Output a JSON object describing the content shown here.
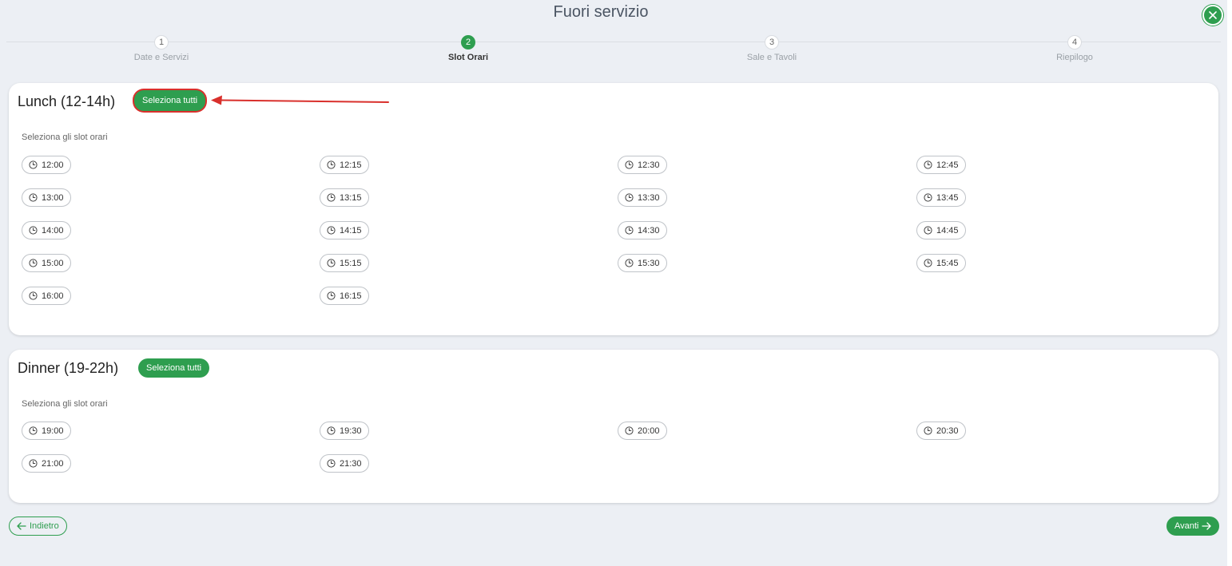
{
  "page_title": "Fuori servizio",
  "steps": [
    {
      "number": "1",
      "label": "Date e Servizi",
      "active": false
    },
    {
      "number": "2",
      "label": "Slot Orari",
      "active": true
    },
    {
      "number": "3",
      "label": "Sale e Tavoli",
      "active": false
    },
    {
      "number": "4",
      "label": "Riepilogo",
      "active": false
    }
  ],
  "lunch": {
    "title": "Lunch (12-14h)",
    "select_all_label": "Seleziona tutti",
    "slots_label": "Seleziona gli slot orari",
    "slots": [
      "12:00",
      "12:15",
      "12:30",
      "12:45",
      "13:00",
      "13:15",
      "13:30",
      "13:45",
      "14:00",
      "14:15",
      "14:30",
      "14:45",
      "15:00",
      "15:15",
      "15:30",
      "15:45",
      "16:00",
      "16:15"
    ]
  },
  "dinner": {
    "title": "Dinner (19-22h)",
    "select_all_label": "Seleziona tutti",
    "slots_label": "Seleziona gli slot orari",
    "slots": [
      "19:00",
      "19:30",
      "20:00",
      "20:30",
      "21:00",
      "21:30"
    ]
  },
  "footer": {
    "back_label": "Indietro",
    "next_label": "Avanti"
  },
  "colors": {
    "accent": "#2e9e4f",
    "annotation": "#d9302c",
    "background": "#eceff4"
  },
  "icons": {
    "close": "close-icon",
    "slot": "clock-icon",
    "back": "arrow-left-icon",
    "next": "arrow-right-icon"
  }
}
